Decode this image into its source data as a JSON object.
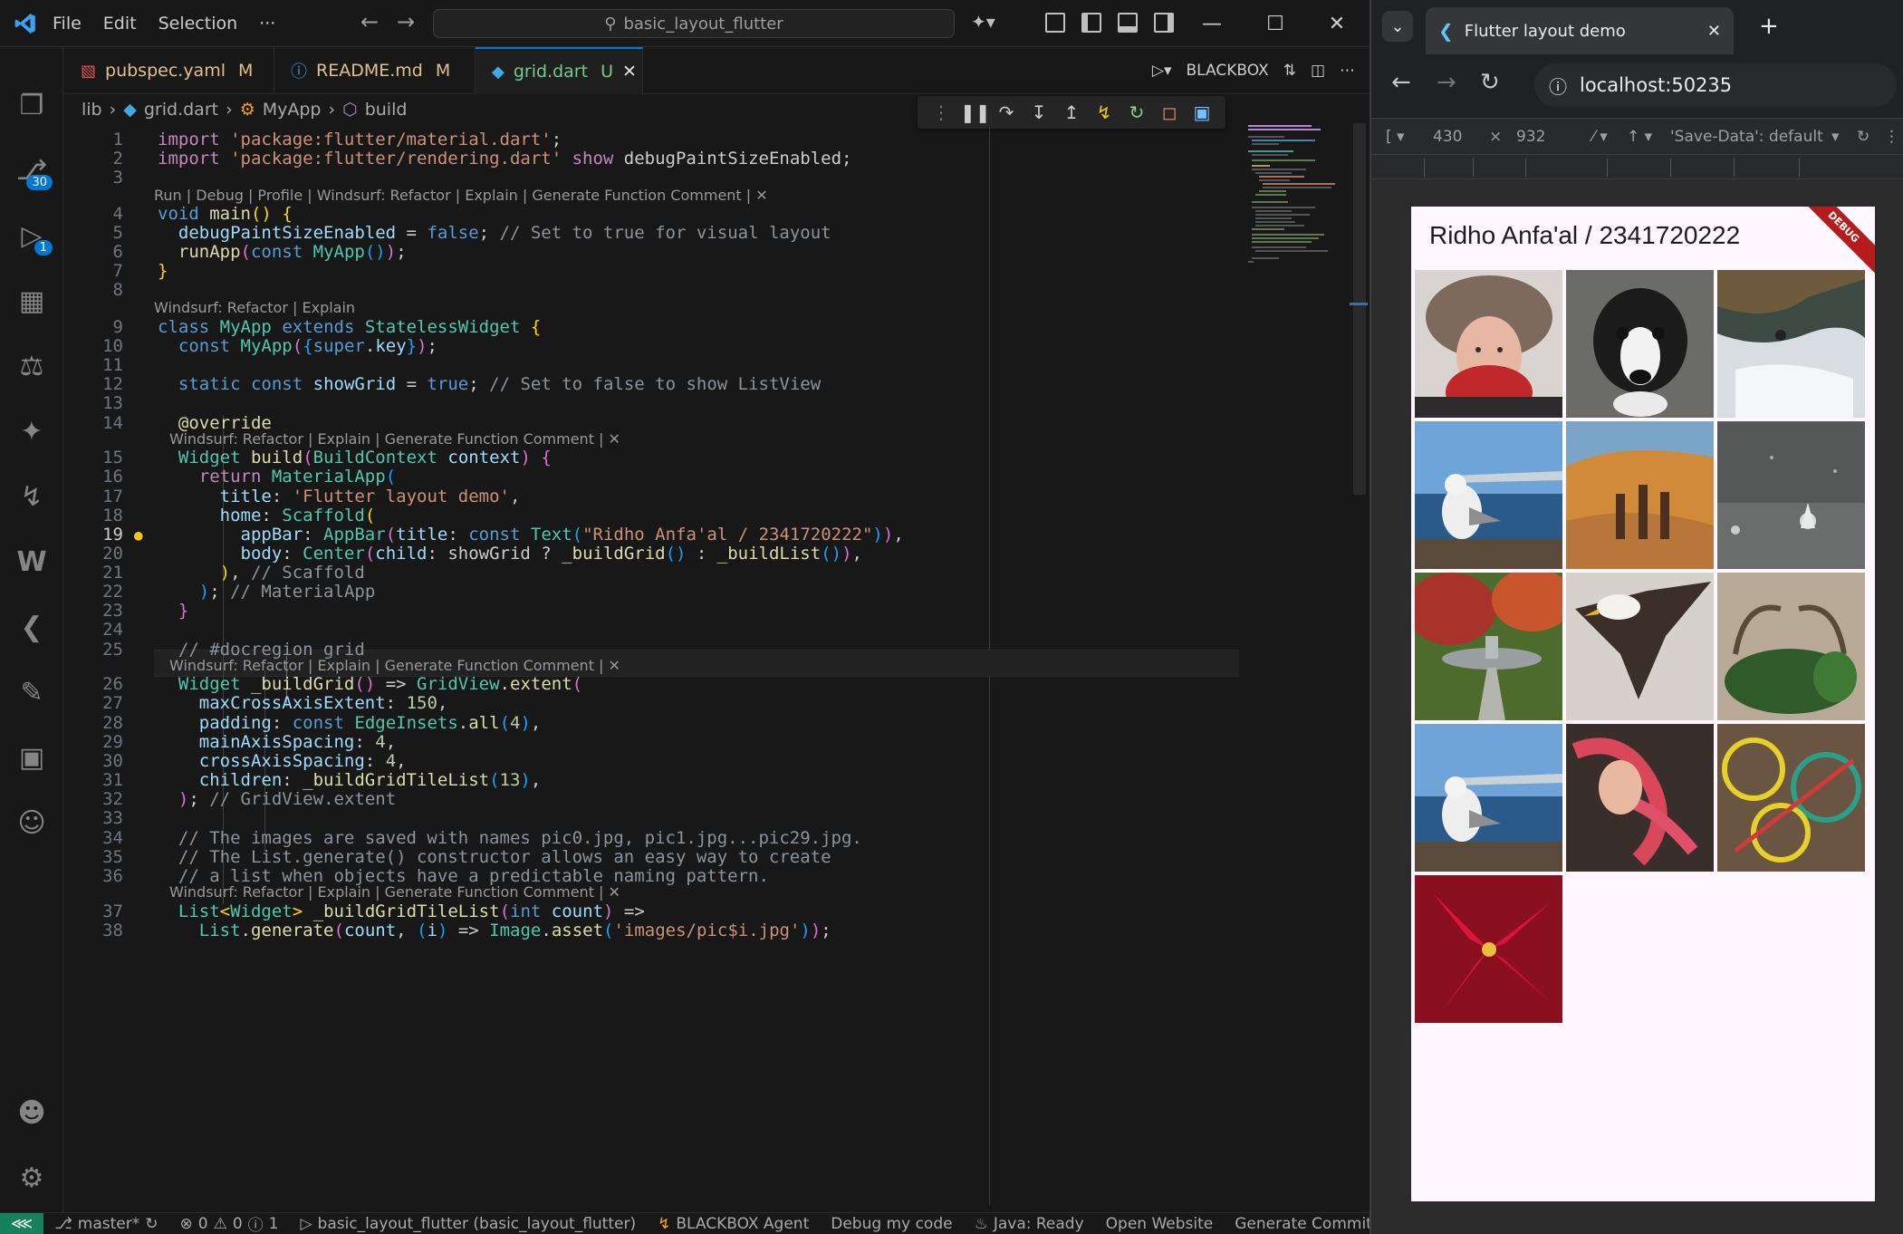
{
  "vscode": {
    "menu": [
      "File",
      "Edit",
      "Selection",
      "···"
    ],
    "search_text": "basic_layout_flutter",
    "tabs": [
      {
        "name": "pubspec.yaml",
        "status": "M",
        "color": "#e2c08d"
      },
      {
        "name": "README.md",
        "status": "M",
        "color": "#e2c08d"
      },
      {
        "name": "grid.dart",
        "status": "U",
        "color": "#73c991"
      }
    ],
    "blackbox_label": "BLACKBOX",
    "breadcrumb": [
      "lib",
      "grid.dart",
      "MyApp",
      "build"
    ],
    "activity_badges": {
      "source_control": "30",
      "run_debug": "1"
    },
    "codelens": {
      "main": "Run | Debug | Profile | Windsurf: Refactor | Explain | Generate Function Comment | ✕",
      "class": "Windsurf: Refactor | Explain",
      "method": "Windsurf: Refactor | Explain | Generate Function Comment | ✕"
    },
    "status": {
      "branch": "master*",
      "problems": "0",
      "warnings": "0",
      "info": "1",
      "debug_target": "basic_layout_flutter (basic_layout_flutter)",
      "blackbox_agent": "BLACKBOX Agent",
      "debug_code": "Debug my code",
      "java": "Java: Ready",
      "open_website": "Open Website",
      "generate_commit": "Generate Commit Mes"
    }
  },
  "browser": {
    "tab_title": "Flutter layout demo",
    "url": "localhost:50235",
    "device_width": "430",
    "device_height": "932",
    "save_data": "'Save-Data': default",
    "dim_sep": "×",
    "app": {
      "title": "Ridho Anfa'al / 2341720222",
      "debug_banner": "DEBUG",
      "tile_count": 13
    }
  },
  "colors": {
    "accent": "#0078d4",
    "keyword": "#569cd6",
    "control": "#c586c0",
    "string": "#ce9178",
    "function": "#dcdcaa",
    "type": "#4ec9b0",
    "variable": "#9cdcfe",
    "number": "#b5cea8",
    "comment": "#6a9955"
  }
}
